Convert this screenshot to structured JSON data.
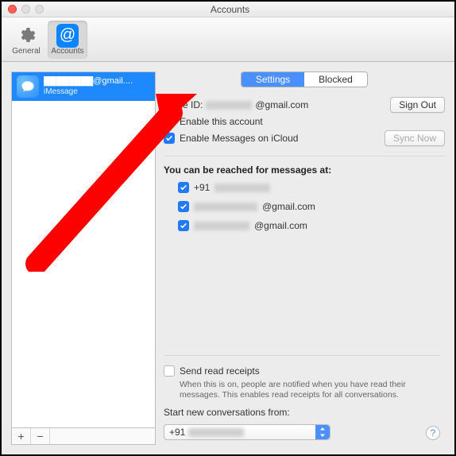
{
  "window": {
    "title": "Accounts"
  },
  "toolbar": {
    "general": "General",
    "accounts": "Accounts"
  },
  "sidebar": {
    "account": {
      "title": "████████@gmail....",
      "subtitle": "iMessage"
    },
    "add": "+",
    "remove": "−"
  },
  "tabs": {
    "settings": "Settings",
    "blocked": "Blocked"
  },
  "appleid": {
    "label": "Apple ID:",
    "value_suffix": "@gmail.com",
    "signout": "Sign Out"
  },
  "checks": {
    "enable_account": "Enable this account",
    "enable_icloud": "Enable Messages on iCloud",
    "sync_now": "Sync Now"
  },
  "reach": {
    "heading": "You can be reached for messages at:",
    "items": [
      {
        "prefix": "+91",
        "suffix": ""
      },
      {
        "prefix": "",
        "suffix": "@gmail.com"
      },
      {
        "prefix": "",
        "suffix": "@gmail.com"
      }
    ]
  },
  "receipts": {
    "label": "Send read receipts",
    "desc": "When this is on, people are notified when you have read their messages. This enables read receipts for all conversations."
  },
  "startfrom": {
    "label": "Start new conversations from:",
    "value_prefix": "+91"
  },
  "help": "?"
}
